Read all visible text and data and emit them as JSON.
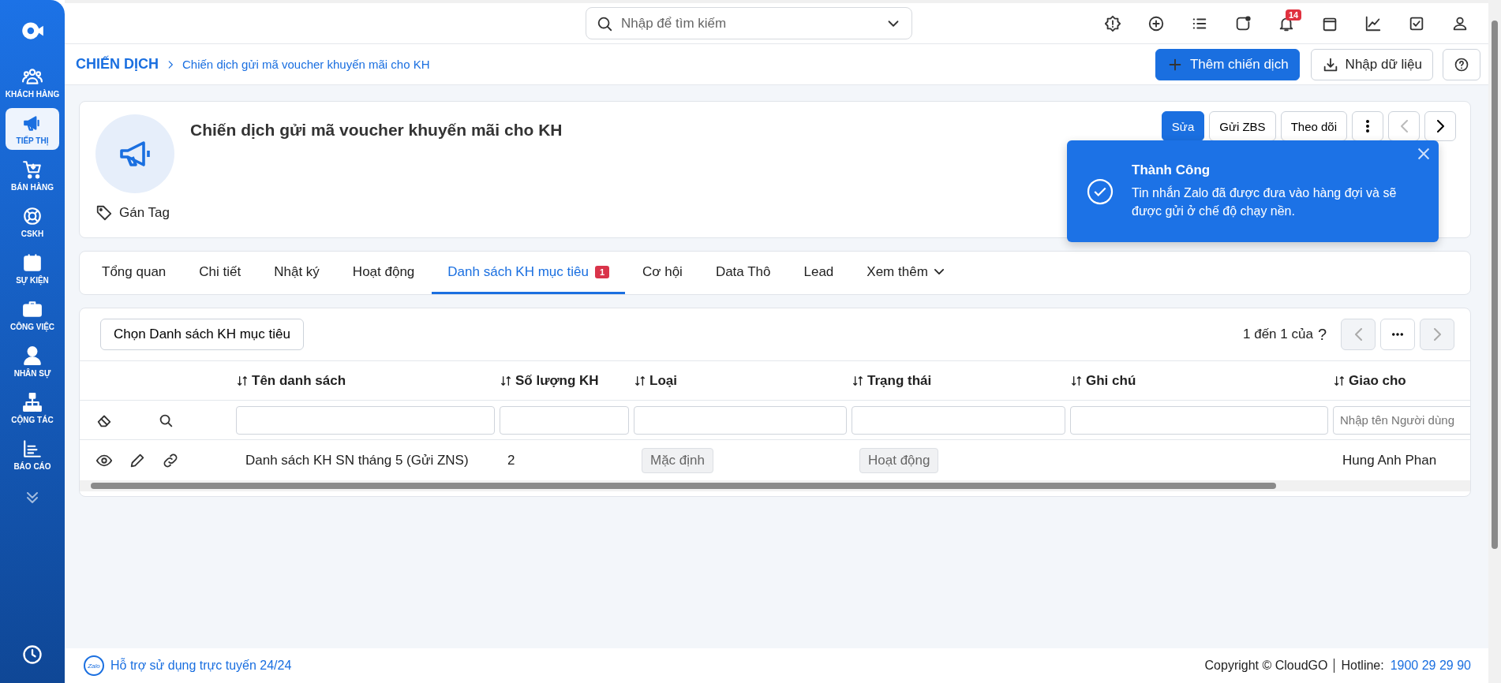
{
  "sidebar": {
    "items": [
      {
        "label": "KHÁCH HÀNG",
        "kind": "users",
        "selected": false
      },
      {
        "label": "TIẾP THỊ",
        "kind": "megaphone",
        "selected": true
      },
      {
        "label": "BÁN HÀNG",
        "kind": "cart",
        "selected": false
      },
      {
        "label": "CSKH",
        "kind": "lifebuoy",
        "selected": false
      },
      {
        "label": "SỰ KIỆN",
        "kind": "calendar",
        "selected": false
      },
      {
        "label": "CÔNG VIỆC",
        "kind": "briefcase",
        "selected": false
      },
      {
        "label": "NHÂN SỰ",
        "kind": "person",
        "selected": false
      },
      {
        "label": "CỘNG TÁC",
        "kind": "org",
        "selected": false
      },
      {
        "label": "BÁO CÁO",
        "kind": "chart",
        "selected": false
      }
    ]
  },
  "search": {
    "placeholder": "Nhập để tìm kiếm"
  },
  "notifications": {
    "count": "14"
  },
  "breadcrumb": [
    {
      "label": "CHIẾN DỊCH"
    },
    {
      "label": "Chiến dịch gửi mã voucher khuyến mãi cho KH"
    }
  ],
  "page_actions": [
    {
      "label": "Thêm chiến dịch",
      "kind": "primary"
    },
    {
      "label": "Nhập dữ liệu",
      "kind": "import"
    }
  ],
  "record": {
    "title": "Chiến dịch gửi mã voucher khuyến mãi cho KH",
    "tag_label": "Gán Tag",
    "actions": [
      {
        "label": "Sửa",
        "kind": "primary"
      },
      {
        "label": "Gửi ZBS",
        "kind": "plain"
      },
      {
        "label": "Theo dõi",
        "kind": "plain"
      }
    ]
  },
  "toast": {
    "title": "Thành Công",
    "message": "Tin nhắn Zalo đã được đưa vào hàng đợi và sẽ được gửi ở chế độ chạy nền."
  },
  "tabs": [
    {
      "label": "Tổng quan",
      "selected": false
    },
    {
      "label": "Chi tiết",
      "selected": false
    },
    {
      "label": "Nhật ký",
      "selected": false
    },
    {
      "label": "Hoạt động",
      "selected": false
    },
    {
      "label": "Danh sách KH mục tiêu",
      "selected": true,
      "badge": "1"
    },
    {
      "label": "Cơ hội",
      "selected": false
    },
    {
      "label": "Data Thô",
      "selected": false
    },
    {
      "label": "Lead",
      "selected": false
    },
    {
      "label": "Xem thêm",
      "selected": false,
      "dropdown": true
    }
  ],
  "table": {
    "select_button": "Chọn Danh sách KH mục tiêu",
    "pager": "1 đến 1 của",
    "pager_help": "?",
    "columns": [
      {
        "label": "Tên danh sách"
      },
      {
        "label": "Số lượng KH"
      },
      {
        "label": "Loại"
      },
      {
        "label": "Trạng thái"
      },
      {
        "label": "Ghi chú"
      },
      {
        "label": "Giao cho",
        "placeholder": "Nhập tên Người dùng"
      }
    ],
    "rows": [
      {
        "cells": [
          {
            "text": "Danh sách KH SN tháng 5 (Gửi ZNS)"
          },
          {
            "text": "2"
          },
          {
            "text": "Mặc định",
            "kind": "tag"
          },
          {
            "text": "Hoạt động",
            "kind": "tag"
          },
          {},
          {
            "text": "Hung Anh Phan"
          }
        ]
      }
    ]
  },
  "footer": {
    "logo": "Zalo",
    "support": "Hỗ trợ sử dụng trực tuyến 24/24",
    "copyright": "Copyright © CloudGO",
    "hotline_label": "Hotline:",
    "hotline": "1900 29 29 90"
  }
}
